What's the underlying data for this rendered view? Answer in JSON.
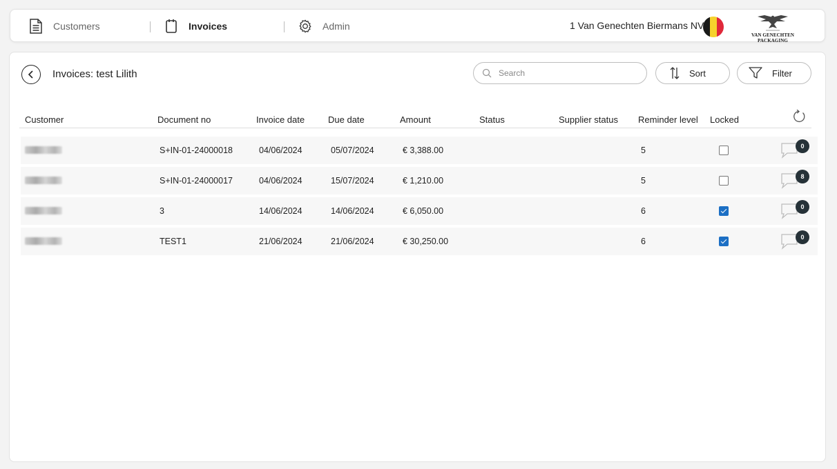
{
  "nav": {
    "items": [
      {
        "label": "Customers",
        "icon": "document-icon",
        "active": false
      },
      {
        "label": "Invoices",
        "icon": "notebook-icon",
        "active": true
      },
      {
        "label": "Admin",
        "icon": "gear-icon",
        "active": false
      }
    ],
    "company": "1 Van Genechten Biermans NV",
    "flag_colors": [
      "#1a1a1a",
      "#f6d22c",
      "#e0283a"
    ],
    "logo_text": "VAN GENECHTEN PACKAGING"
  },
  "page": {
    "title": "Invoices: test Lilith",
    "search_placeholder": "Search",
    "sort_label": "Sort",
    "filter_label": "Filter"
  },
  "table": {
    "columns": [
      "Customer",
      "Document no",
      "Invoice date",
      "Due date",
      "Amount",
      "Status",
      "Supplier status",
      "Reminder level",
      "Locked"
    ],
    "rows": [
      {
        "document_no": "S+IN-01-24000018",
        "invoice_date": "04/06/2024",
        "due_date": "05/07/2024",
        "amount": "€ 3,388.00",
        "status": "",
        "supplier_status": "",
        "reminder_level": "5",
        "locked": false,
        "comments": "0"
      },
      {
        "document_no": "S+IN-01-24000017",
        "invoice_date": "04/06/2024",
        "due_date": "15/07/2024",
        "amount": "€ 1,210.00",
        "status": "",
        "supplier_status": "",
        "reminder_level": "5",
        "locked": false,
        "comments": "8"
      },
      {
        "document_no": "3",
        "invoice_date": "14/06/2024",
        "due_date": "14/06/2024",
        "amount": "€ 6,050.00",
        "status": "",
        "supplier_status": "",
        "reminder_level": "6",
        "locked": true,
        "comments": "0"
      },
      {
        "document_no": "TEST1",
        "invoice_date": "21/06/2024",
        "due_date": "21/06/2024",
        "amount": "€ 30,250.00",
        "status": "",
        "supplier_status": "",
        "reminder_level": "6",
        "locked": true,
        "comments": "0"
      }
    ]
  },
  "colors": {
    "accent": "#1c6fc4",
    "badge": "#263238"
  }
}
